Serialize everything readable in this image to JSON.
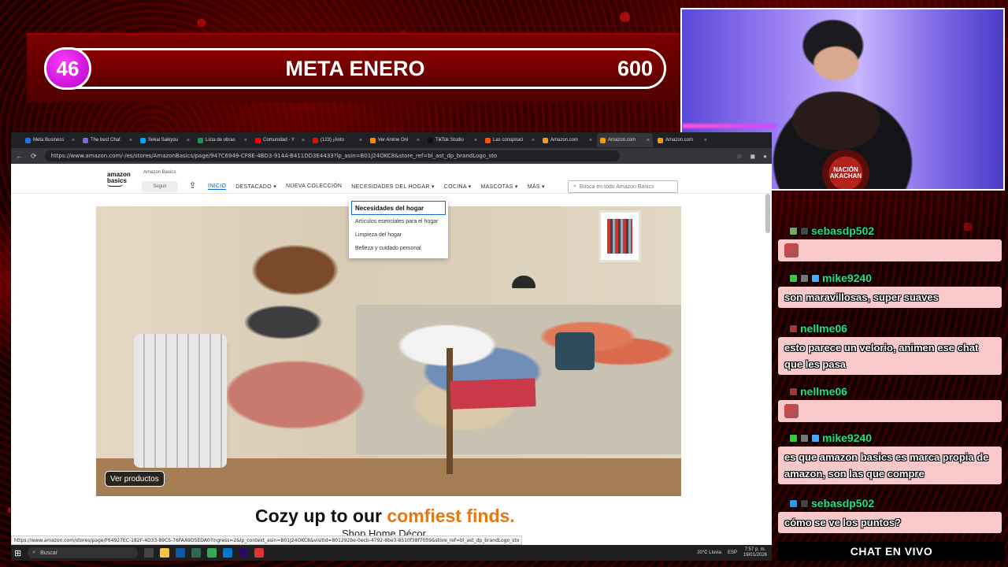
{
  "meta": {
    "current": "46",
    "title": "META ENERO",
    "goal": "600"
  },
  "webcam": {
    "logo_text": "NACIÓN AKACHAN"
  },
  "browser": {
    "tabs": [
      {
        "label": "Meta Business",
        "color": "#1877f2"
      },
      {
        "label": "The best Chat",
        "color": "#7b68ee"
      },
      {
        "label": "Sekai Saikyou",
        "color": "#00a2ff"
      },
      {
        "label": "Lista de obras",
        "color": "#0f9d58"
      },
      {
        "label": "Comunidad - Y",
        "color": "#ff0000"
      },
      {
        "label": "(123) ¡Anto",
        "color": "#ff0000"
      },
      {
        "label": "Ver Anime Onl",
        "color": "#ff8a00"
      },
      {
        "label": "TikTok Studio",
        "color": "#111111"
      },
      {
        "label": "Las conspiraci",
        "color": "#ff5500"
      },
      {
        "label": "Amazon.com",
        "color": "#ff9900"
      },
      {
        "label": "Amazon.com",
        "color": "#ff9900",
        "active": true
      },
      {
        "label": "Amazon.com",
        "color": "#ff9900"
      }
    ],
    "url": "https://www.amazon.com/-/es/stores/AmazonBasics/page/947C6949-CF8E-4BD3-914A-B411DD3E4433?lp_asin=B01J24OKC8&store_ref=bl_ast_dp_brandLogo_sto",
    "status_url": "https://www.amazon.com/stores/page/F64927EC-182F-4D33-89C5-76FAA9D5EDA0?ingress=2&lp_context_asin=B01J24OKC8&visitId=801292be-0ecb-4792-8be3-8510f38f7059&store_ref=bl_ast_dp_brandLogo_sto"
  },
  "amazon": {
    "logo_line1": "amazon",
    "logo_line2": "basics",
    "brand_label": "Amazon Basics",
    "follow": "Seguir",
    "nav": [
      "INICIO",
      "DESTACADO ▾",
      "NUEVA COLECCIÓN",
      "NECESIDADES DEL HOGAR ▾",
      "COCINA ▾",
      "MASCOTAS ▾",
      "MÁS ▾"
    ],
    "search_placeholder": "Busca en todo Amazon Basics",
    "dropdown": [
      "Necesidades del hogar",
      "Artículos esenciales para el hogar",
      "Limpieza del hogar",
      "Belleza y cuidado personal"
    ],
    "hero_button": "Ver productos",
    "tagline_a": "Cozy up to our ",
    "tagline_b": "comfiest finds.",
    "subtag": "Shop Home Décor"
  },
  "taskbar": {
    "search": "Buscar",
    "weather": "20°C Lluvia",
    "lang": "ESP",
    "time": "7:57 p. m.",
    "date": "19/01/2026"
  },
  "chat": {
    "messages": [
      {
        "user": "sebasdp502",
        "text": "",
        "emote": true,
        "badges": [
          "#7a5",
          "#444"
        ]
      },
      {
        "user": "mike9240",
        "text": "son maravillosas, super suaves",
        "badges": [
          "#3c3",
          "#777",
          "#4af"
        ]
      },
      {
        "user": "nellme06",
        "text": "esto parece un velorio, animen ese chat que les pasa",
        "badges": [
          "#a33"
        ]
      },
      {
        "user": "nellme06",
        "text": "",
        "emote": true,
        "badges": [
          "#a33"
        ]
      },
      {
        "user": "mike9240",
        "text": "es que amazon basics es marca propia de amazon, son las que compre",
        "badges": [
          "#3c3",
          "#777",
          "#4af"
        ]
      },
      {
        "user": "sebasdp502",
        "text": "cómo se ve los puntos?",
        "badges": [
          "#29f",
          "#444"
        ]
      }
    ],
    "footer": "CHAT EN VIVO"
  }
}
